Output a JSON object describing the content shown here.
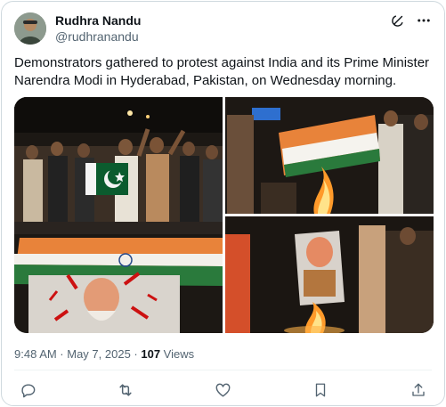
{
  "tweet": {
    "author": {
      "display_name": "Rudhra Nandu",
      "handle": "@rudhranandu"
    },
    "text": "Demonstrators gathered to protest against India and its Prime Minister Narendra Modi in Hyderabad, Pakistan, on Wednesday morning.",
    "timestamp": "9:48 AM · May 7, 2025 · ",
    "views_count": "107",
    "views_label": " Views",
    "media": [
      {
        "icon": "protest-photo-crowd-with-flags"
      },
      {
        "icon": "protest-photo-flag-burning"
      },
      {
        "icon": "protest-photo-effigy-burning"
      }
    ]
  },
  "actions": {
    "icons": [
      "reply-icon",
      "retweet-icon",
      "like-icon",
      "bookmark-icon",
      "share-icon"
    ]
  },
  "header_icons": [
    "grok-icon",
    "more-icon"
  ],
  "colors": {
    "text_primary": "#0f1419",
    "text_secondary": "#536471",
    "border": "#cfd9de"
  }
}
